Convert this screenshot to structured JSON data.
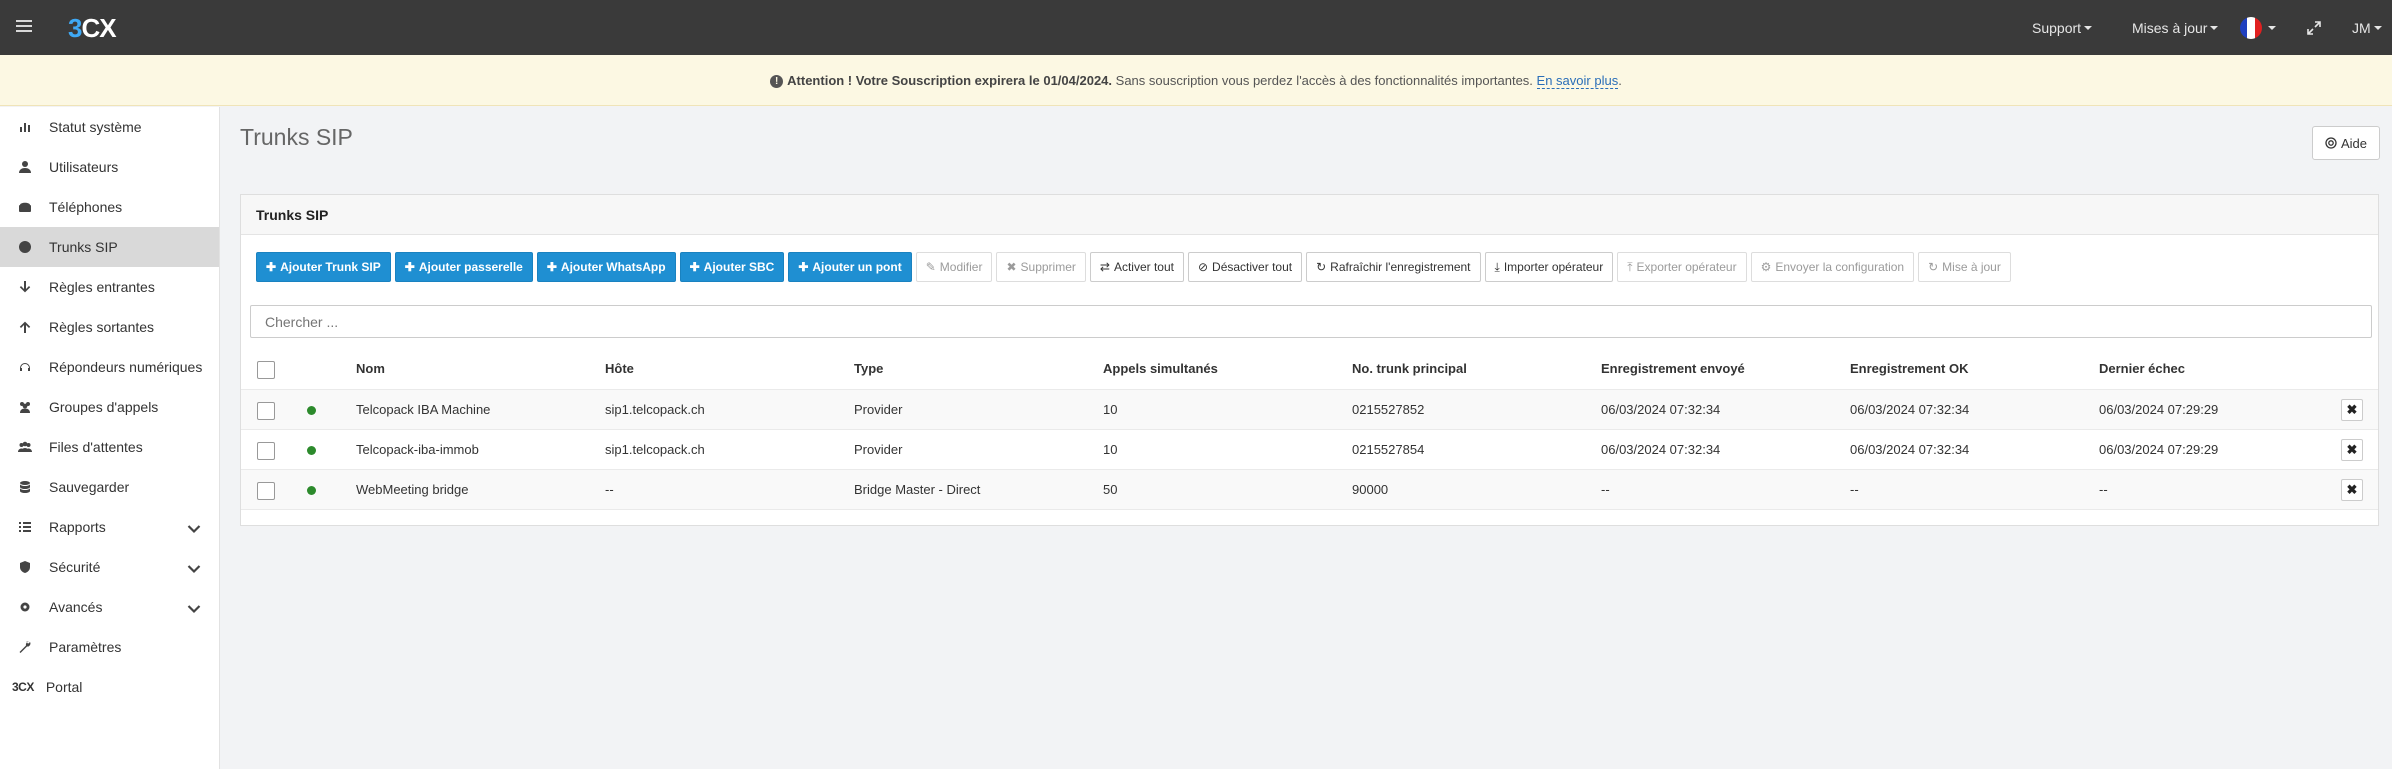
{
  "navbar": {
    "logo": "3CX",
    "support_label": "Support",
    "updates_label": "Mises à jour",
    "language_flag_colors": [
      "#1f3fbf",
      "#ffffff",
      "#e02020"
    ],
    "user_initials": "JM"
  },
  "alert": {
    "prefix": "Attention ! Votre Souscription expirera le 01/04/2024.",
    "message": "Sans souscription vous perdez l'accès à des fonctionnalités importantes.",
    "link": "En savoir plus",
    "suffix": "."
  },
  "sidebar": {
    "items": [
      {
        "label": "Statut système",
        "icon": "bar-chart-icon"
      },
      {
        "label": "Utilisateurs",
        "icon": "user-icon"
      },
      {
        "label": "Téléphones",
        "icon": "phone-icon"
      },
      {
        "label": "Trunks SIP",
        "icon": "globe-icon",
        "active": true
      },
      {
        "label": "Règles entrantes",
        "icon": "arrow-down-icon"
      },
      {
        "label": "Règles sortantes",
        "icon": "arrow-up-icon"
      },
      {
        "label": "Répondeurs numériques",
        "icon": "headset-icon"
      },
      {
        "label": "Groupes d'appels",
        "icon": "users-icon"
      },
      {
        "label": "Files d'attentes",
        "icon": "group-icon"
      },
      {
        "label": "Sauvegarder",
        "icon": "database-icon"
      },
      {
        "label": "Rapports",
        "icon": "list-icon",
        "expandable": true
      },
      {
        "label": "Sécurité",
        "icon": "shield-icon",
        "expandable": true
      },
      {
        "label": "Avancés",
        "icon": "gear-icon",
        "expandable": true
      },
      {
        "label": "Paramètres",
        "icon": "wrench-icon"
      },
      {
        "label": "Portal",
        "icon": "3cx-logo"
      }
    ]
  },
  "page": {
    "title": "Trunks SIP",
    "help_label": "Aide"
  },
  "panel": {
    "title": "Trunks SIP",
    "buttons": [
      {
        "label": "Ajouter Trunk SIP",
        "style": "primary",
        "icon": "plus-icon"
      },
      {
        "label": "Ajouter passerelle",
        "style": "primary",
        "icon": "plus-icon"
      },
      {
        "label": "Ajouter WhatsApp",
        "style": "primary",
        "icon": "plus-icon"
      },
      {
        "label": "Ajouter SBC",
        "style": "primary",
        "icon": "plus-icon"
      },
      {
        "label": "Ajouter un pont",
        "style": "primary",
        "icon": "plus-icon"
      },
      {
        "label": "Modifier",
        "style": "disabled",
        "icon": "pencil-icon"
      },
      {
        "label": "Supprimer",
        "style": "disabled",
        "icon": "times-icon"
      },
      {
        "label": "Activer tout",
        "style": "default",
        "icon": "shuffle-icon"
      },
      {
        "label": "Désactiver tout",
        "style": "default",
        "icon": "ban-icon"
      },
      {
        "label": "Rafraîchir l'enregistrement",
        "style": "default",
        "icon": "refresh-icon"
      },
      {
        "label": "Importer opérateur",
        "style": "default",
        "icon": "download-icon"
      },
      {
        "label": "Exporter opérateur",
        "style": "disabled",
        "icon": "upload-icon"
      },
      {
        "label": "Envoyer la configuration",
        "style": "disabled",
        "icon": "gear-icon"
      },
      {
        "label": "Mise à jour",
        "style": "disabled",
        "icon": "refresh-icon"
      }
    ],
    "search_placeholder": "Chercher ..."
  },
  "table": {
    "columns": [
      "Nom",
      "Hôte",
      "Type",
      "Appels simultanés",
      "No. trunk principal",
      "Enregistrement envoyé",
      "Enregistrement OK",
      "Dernier échec"
    ],
    "status_color": "#2c8a2c",
    "rows": [
      [
        "Telcopack IBA Machine",
        "sip1.telcopack.ch",
        "Provider",
        "10",
        "0215527852",
        "06/03/2024 07:32:34",
        "06/03/2024 07:32:34",
        "06/03/2024 07:29:29"
      ],
      [
        "Telcopack-iba-immob",
        "sip1.telcopack.ch",
        "Provider",
        "10",
        "0215527854",
        "06/03/2024 07:32:34",
        "06/03/2024 07:32:34",
        "06/03/2024 07:29:29"
      ],
      [
        "WebMeeting bridge",
        "--",
        "Bridge Master - Direct",
        "50",
        "90000",
        "--",
        "--",
        "--"
      ]
    ]
  }
}
